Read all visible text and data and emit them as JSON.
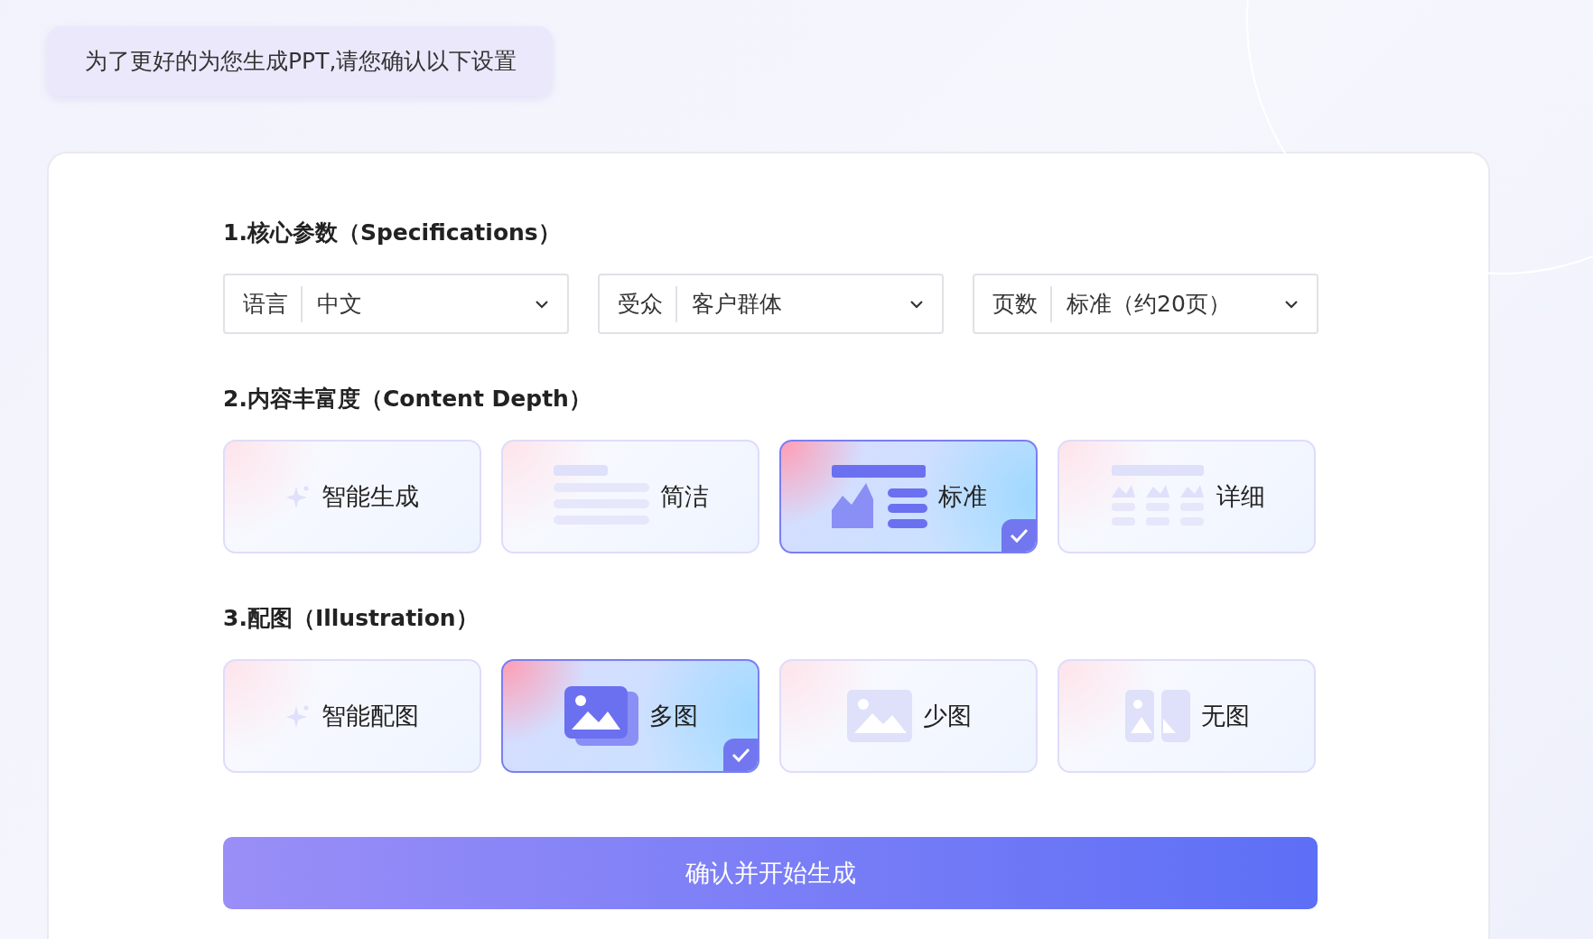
{
  "banner": {
    "text": "为了更好的为您生成PPT,请您确认以下设置"
  },
  "sections": [
    {
      "kind": "dropdowns",
      "title": "1.核心参数（Specifications）",
      "dropdowns": [
        {
          "label": "语言",
          "value": "中文"
        },
        {
          "label": "受众",
          "value": "客户群体"
        },
        {
          "label": "页数",
          "value": "标准（约20页）"
        }
      ]
    },
    {
      "kind": "options",
      "title": "2.内容丰富度（Content Depth）",
      "options": [
        {
          "kind": "sparkle",
          "label": "智能生成",
          "selected": false
        },
        {
          "kind": "lines",
          "label": "简洁",
          "selected": false
        },
        {
          "kind": "chart",
          "label": "标准",
          "selected": true
        },
        {
          "kind": "grid",
          "label": "详细",
          "selected": false
        }
      ]
    },
    {
      "kind": "options",
      "title": "3.配图（Illustration）",
      "options": [
        {
          "kind": "sparkle",
          "label": "智能配图",
          "selected": false
        },
        {
          "kind": "images",
          "label": "多图",
          "selected": true
        },
        {
          "kind": "image",
          "label": "少图",
          "selected": false
        },
        {
          "kind": "split",
          "label": "无图",
          "selected": false
        }
      ]
    }
  ],
  "confirm_button": "确认并开始生成"
}
